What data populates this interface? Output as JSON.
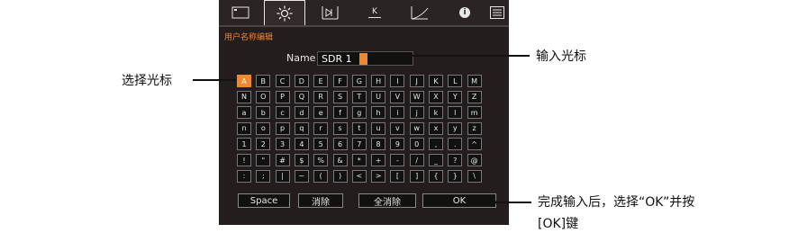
{
  "tabs": [
    {
      "icon": "picture-mode-icon"
    },
    {
      "icon": "brightness-icon",
      "active": true
    },
    {
      "icon": "input-signal-icon"
    },
    {
      "icon": "color-temp-icon",
      "label": "K"
    },
    {
      "icon": "gamma-curve-icon"
    },
    {
      "icon": "info-icon",
      "label": "i"
    },
    {
      "icon": "menu-icon"
    }
  ],
  "dialog": {
    "title": "用户名称编辑",
    "name_label": "Name",
    "name_value": "SDR 1"
  },
  "keyboard": {
    "rows": [
      [
        "A",
        "B",
        "C",
        "D",
        "E",
        "F",
        "G",
        "H",
        "I",
        "J",
        "K",
        "L",
        "M"
      ],
      [
        "N",
        "O",
        "P",
        "Q",
        "R",
        "S",
        "T",
        "U",
        "V",
        "W",
        "X",
        "Y",
        "Z"
      ],
      [
        "a",
        "b",
        "c",
        "d",
        "e",
        "f",
        "g",
        "h",
        "i",
        "j",
        "k",
        "l",
        "m"
      ],
      [
        "n",
        "o",
        "p",
        "q",
        "r",
        "s",
        "t",
        "u",
        "v",
        "w",
        "x",
        "y",
        "z"
      ],
      [
        "1",
        "2",
        "3",
        "4",
        "5",
        "6",
        "7",
        "8",
        "9",
        "0",
        ",",
        ".",
        "^"
      ],
      [
        "!",
        "\"",
        "#",
        "$",
        "%",
        "&",
        "*",
        "+",
        "-",
        "/",
        "_",
        "?",
        "@"
      ],
      [
        ":",
        ";",
        "|",
        "~",
        "(",
        ")",
        "<",
        ">",
        "[",
        "]",
        "{",
        "}",
        "\\"
      ]
    ],
    "selected": "A"
  },
  "buttons": {
    "space": "Space",
    "delete": "消除",
    "clear_all": "全消除",
    "ok": "OK"
  },
  "annotations": {
    "cursor": "输入光标",
    "select": "选择光标",
    "finish_line1": "完成输入后，选择“OK”并按",
    "finish_line2": "[OK]键"
  }
}
